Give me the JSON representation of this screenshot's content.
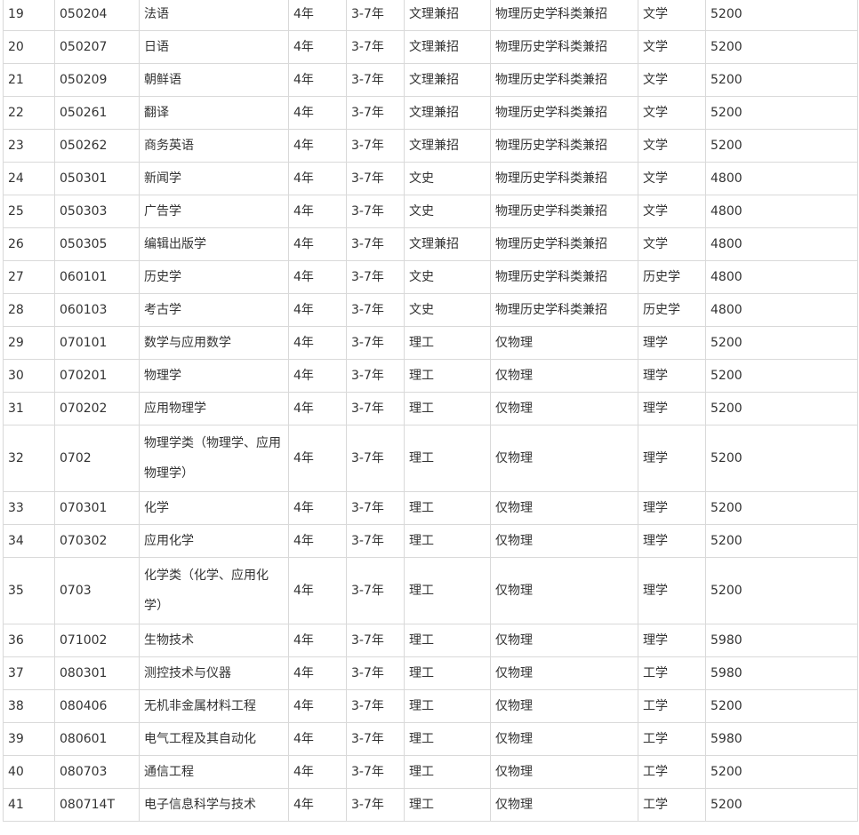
{
  "table": {
    "rows": [
      {
        "no": "19",
        "code": "050204",
        "name": "法语",
        "years": "4年",
        "range": "3-7年",
        "track": "文理兼招",
        "subject": "物理历史学科类兼招",
        "degree": "文学",
        "fee": "5200"
      },
      {
        "no": "20",
        "code": "050207",
        "name": "日语",
        "years": "4年",
        "range": "3-7年",
        "track": "文理兼招",
        "subject": "物理历史学科类兼招",
        "degree": "文学",
        "fee": "5200"
      },
      {
        "no": "21",
        "code": "050209",
        "name": "朝鲜语",
        "years": "4年",
        "range": "3-7年",
        "track": "文理兼招",
        "subject": "物理历史学科类兼招",
        "degree": "文学",
        "fee": "5200"
      },
      {
        "no": "22",
        "code": "050261",
        "name": "翻译",
        "years": "4年",
        "range": "3-7年",
        "track": "文理兼招",
        "subject": "物理历史学科类兼招",
        "degree": "文学",
        "fee": "5200"
      },
      {
        "no": "23",
        "code": "050262",
        "name": "商务英语",
        "years": "4年",
        "range": "3-7年",
        "track": "文理兼招",
        "subject": "物理历史学科类兼招",
        "degree": "文学",
        "fee": "5200"
      },
      {
        "no": "24",
        "code": "050301",
        "name": "新闻学",
        "years": "4年",
        "range": "3-7年",
        "track": "文史",
        "subject": "物理历史学科类兼招",
        "degree": "文学",
        "fee": "4800"
      },
      {
        "no": "25",
        "code": "050303",
        "name": "广告学",
        "years": "4年",
        "range": "3-7年",
        "track": "文史",
        "subject": "物理历史学科类兼招",
        "degree": "文学",
        "fee": "4800"
      },
      {
        "no": "26",
        "code": "050305",
        "name": "编辑出版学",
        "years": "4年",
        "range": "3-7年",
        "track": "文理兼招",
        "subject": "物理历史学科类兼招",
        "degree": "文学",
        "fee": "4800"
      },
      {
        "no": "27",
        "code": "060101",
        "name": "历史学",
        "years": "4年",
        "range": "3-7年",
        "track": "文史",
        "subject": "物理历史学科类兼招",
        "degree": "历史学",
        "fee": "4800"
      },
      {
        "no": "28",
        "code": "060103",
        "name": "考古学",
        "years": "4年",
        "range": "3-7年",
        "track": "文史",
        "subject": "物理历史学科类兼招",
        "degree": "历史学",
        "fee": "4800"
      },
      {
        "no": "29",
        "code": "070101",
        "name": "数学与应用数学",
        "years": "4年",
        "range": "3-7年",
        "track": "理工",
        "subject": "仅物理",
        "degree": "理学",
        "fee": "5200"
      },
      {
        "no": "30",
        "code": "070201",
        "name": "物理学",
        "years": "4年",
        "range": "3-7年",
        "track": "理工",
        "subject": "仅物理",
        "degree": "理学",
        "fee": "5200"
      },
      {
        "no": "31",
        "code": "070202",
        "name": "应用物理学",
        "years": "4年",
        "range": "3-7年",
        "track": "理工",
        "subject": "仅物理",
        "degree": "理学",
        "fee": "5200"
      },
      {
        "no": "32",
        "code": "0702",
        "name": "物理学类（物理学、应用物理学）",
        "years": "4年",
        "range": "3-7年",
        "track": "理工",
        "subject": "仅物理",
        "degree": "理学",
        "fee": "5200"
      },
      {
        "no": "33",
        "code": "070301",
        "name": "化学",
        "years": "4年",
        "range": "3-7年",
        "track": "理工",
        "subject": "仅物理",
        "degree": "理学",
        "fee": "5200"
      },
      {
        "no": "34",
        "code": "070302",
        "name": "应用化学",
        "years": "4年",
        "range": "3-7年",
        "track": "理工",
        "subject": "仅物理",
        "degree": "理学",
        "fee": "5200"
      },
      {
        "no": "35",
        "code": "0703",
        "name": "化学类（化学、应用化学）",
        "years": "4年",
        "range": "3-7年",
        "track": "理工",
        "subject": "仅物理",
        "degree": "理学",
        "fee": "5200"
      },
      {
        "no": "36",
        "code": "071002",
        "name": "生物技术",
        "years": "4年",
        "range": "3-7年",
        "track": "理工",
        "subject": "仅物理",
        "degree": "理学",
        "fee": "5980"
      },
      {
        "no": "37",
        "code": "080301",
        "name": "测控技术与仪器",
        "years": "4年",
        "range": "3-7年",
        "track": "理工",
        "subject": "仅物理",
        "degree": "工学",
        "fee": "5980"
      },
      {
        "no": "38",
        "code": "080406",
        "name": "无机非金属材料工程",
        "years": "4年",
        "range": "3-7年",
        "track": "理工",
        "subject": "仅物理",
        "degree": "工学",
        "fee": "5200"
      },
      {
        "no": "39",
        "code": "080601",
        "name": "电气工程及其自动化",
        "years": "4年",
        "range": "3-7年",
        "track": "理工",
        "subject": "仅物理",
        "degree": "工学",
        "fee": "5980"
      },
      {
        "no": "40",
        "code": "080703",
        "name": "通信工程",
        "years": "4年",
        "range": "3-7年",
        "track": "理工",
        "subject": "仅物理",
        "degree": "工学",
        "fee": "5200"
      },
      {
        "no": "41",
        "code": "080714T",
        "name": "电子信息科学与技术",
        "years": "4年",
        "range": "3-7年",
        "track": "理工",
        "subject": "仅物理",
        "degree": "工学",
        "fee": "5200"
      }
    ]
  }
}
